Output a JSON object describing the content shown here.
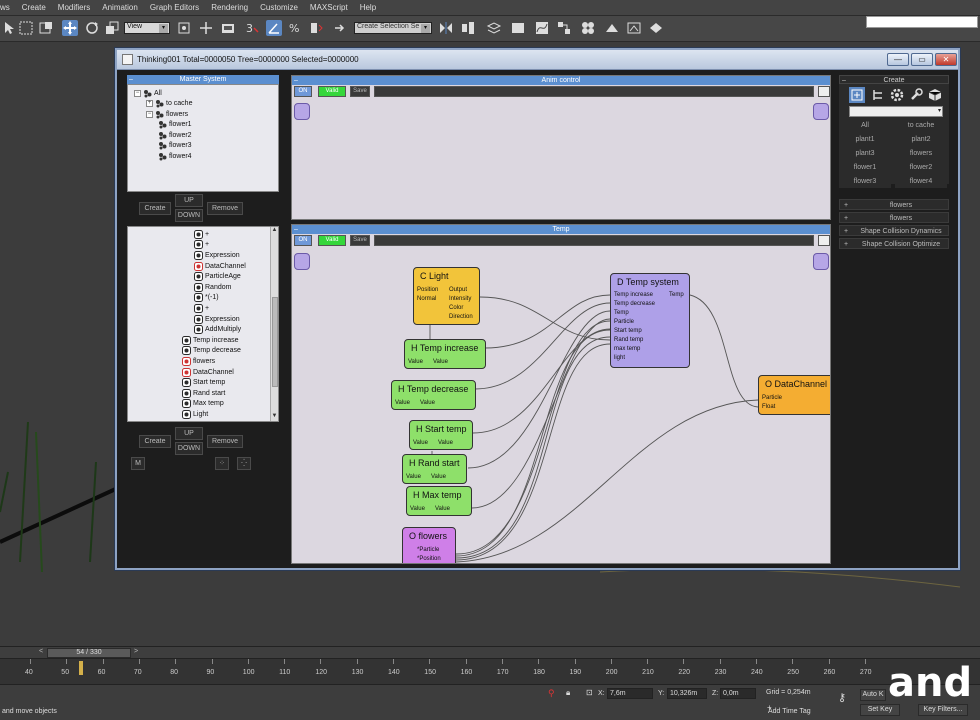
{
  "menubar": [
    "ws",
    "Create",
    "Modifiers",
    "Animation",
    "Graph Editors",
    "Rendering",
    "Customize",
    "MAXScript",
    "Help"
  ],
  "toolbar": {
    "view_select": "View",
    "selection_set": "Create Selection Se",
    "accent": "#5b87c2"
  },
  "window": {
    "title": "Thinking001  Total=0000050  Tree=0000000  Selected=0000000",
    "minimize_label": "—",
    "restore_label": "▭",
    "close_label": "✕"
  },
  "master_system": {
    "header": "Master System",
    "tree": [
      {
        "label": "All",
        "indent": 0
      },
      {
        "label": "to cache",
        "indent": 1
      },
      {
        "label": "flowers",
        "indent": 1
      },
      {
        "label": "flower1",
        "indent": 2
      },
      {
        "label": "flower2",
        "indent": 2
      },
      {
        "label": "flower3",
        "indent": 2
      },
      {
        "label": "flower4",
        "indent": 2
      }
    ],
    "create_label": "Create",
    "up_label": "UP",
    "down_label": "DOWN",
    "remove_label": "Remove"
  },
  "operator_list": {
    "items": [
      {
        "label": "+",
        "indent": 1
      },
      {
        "label": "+",
        "indent": 1
      },
      {
        "label": "Expression",
        "indent": 1
      },
      {
        "label": "DataChannel",
        "indent": 1
      },
      {
        "label": "ParticleAge",
        "indent": 1
      },
      {
        "label": "Random",
        "indent": 1
      },
      {
        "label": "*(-1)",
        "indent": 1
      },
      {
        "label": "+",
        "indent": 1
      },
      {
        "label": "Expression",
        "indent": 1
      },
      {
        "label": "AddMultiply",
        "indent": 1
      },
      {
        "label": "Temp increase",
        "indent": 0
      },
      {
        "label": "Temp decrease",
        "indent": 0
      },
      {
        "label": "flowers",
        "indent": 0
      },
      {
        "label": "DataChannel",
        "indent": 0
      },
      {
        "label": "Start temp",
        "indent": 0
      },
      {
        "label": "Rand start",
        "indent": 0
      },
      {
        "label": "Max temp",
        "indent": 0
      },
      {
        "label": "Light",
        "indent": 0
      }
    ],
    "create_label": "Create",
    "up_label": "UP",
    "down_label": "DOWN",
    "remove_label": "Remove",
    "m_label": "M"
  },
  "anim_control": {
    "header": "Anim control",
    "on_label": "ON",
    "valid_label": "Valid",
    "save_label": "Save"
  },
  "temp_panel": {
    "header": "Temp",
    "on_label": "ON",
    "valid_label": "Valid",
    "save_label": "Save"
  },
  "nodes": {
    "light": {
      "title": "C Light",
      "inputs": [
        "Position",
        "Normal"
      ],
      "outputs": [
        "Output",
        "Intensity",
        "Color",
        "Direction"
      ],
      "color": "#f2c43a"
    },
    "temp_increase": {
      "title": "H Temp increase",
      "ports": [
        "Value",
        "Value"
      ],
      "color": "#8ee06a"
    },
    "temp_decrease": {
      "title": "H Temp decrease",
      "ports": [
        "Value",
        "Value"
      ],
      "color": "#8ee06a"
    },
    "start_temp": {
      "title": "H Start temp",
      "ports": [
        "Value",
        "Value"
      ],
      "color": "#8ee06a"
    },
    "rand_start": {
      "title": "H Rand start",
      "ports": [
        "Value",
        "Value"
      ],
      "color": "#8ee06a"
    },
    "max_temp": {
      "title": "H Max temp",
      "ports": [
        "Value",
        "Value"
      ],
      "color": "#8ee06a"
    },
    "flowers": {
      "title": "O flowers",
      "ports": [
        "*Particle",
        "*Position"
      ],
      "color": "#cf7fe8"
    },
    "temp_system": {
      "title": "D Temp system",
      "inputs": [
        "Temp increase",
        "Temp decrease",
        "Temp",
        "Particle",
        "Start temp",
        "Rand temp",
        "max temp",
        "light"
      ],
      "outputs": [
        "Temp"
      ],
      "color": "#aea0e8"
    },
    "datachannel": {
      "title": "O DataChannel",
      "ports": [
        "Particle",
        "Float"
      ],
      "color": "#f4ad32"
    }
  },
  "create_panel": {
    "header": "Create",
    "buttons": [
      "All",
      "to cache",
      "plant1",
      "plant2",
      "plant3",
      "flowers",
      "flower1",
      "flower2",
      "flower3",
      "flower4"
    ],
    "rollouts": [
      "flowers",
      "flowers",
      "Shape Collision Dynamics",
      "Shape Collision Optimize"
    ]
  },
  "timeline": {
    "slider_label": "54 / 330",
    "ticks": [
      "40",
      "50",
      "60",
      "70",
      "80",
      "90",
      "100",
      "110",
      "120",
      "130",
      "140",
      "150",
      "160",
      "170",
      "180",
      "190",
      "200",
      "210",
      "220",
      "230",
      "240",
      "250",
      "260",
      "270"
    ],
    "current_frame": 54
  },
  "status": {
    "prompt": "and move objects",
    "x_label": "X:",
    "x_value": "7,6m",
    "y_label": "Y:",
    "y_value": "10,326m",
    "z_label": "Z:",
    "z_value": "0,0m",
    "grid": "Grid = 0,254m",
    "add_time_tag": "Add Time Tag",
    "auto_key": "Auto K",
    "set_key": "Set Key",
    "key_filters": "Key Filters..."
  },
  "logo": {
    "text": "and"
  }
}
